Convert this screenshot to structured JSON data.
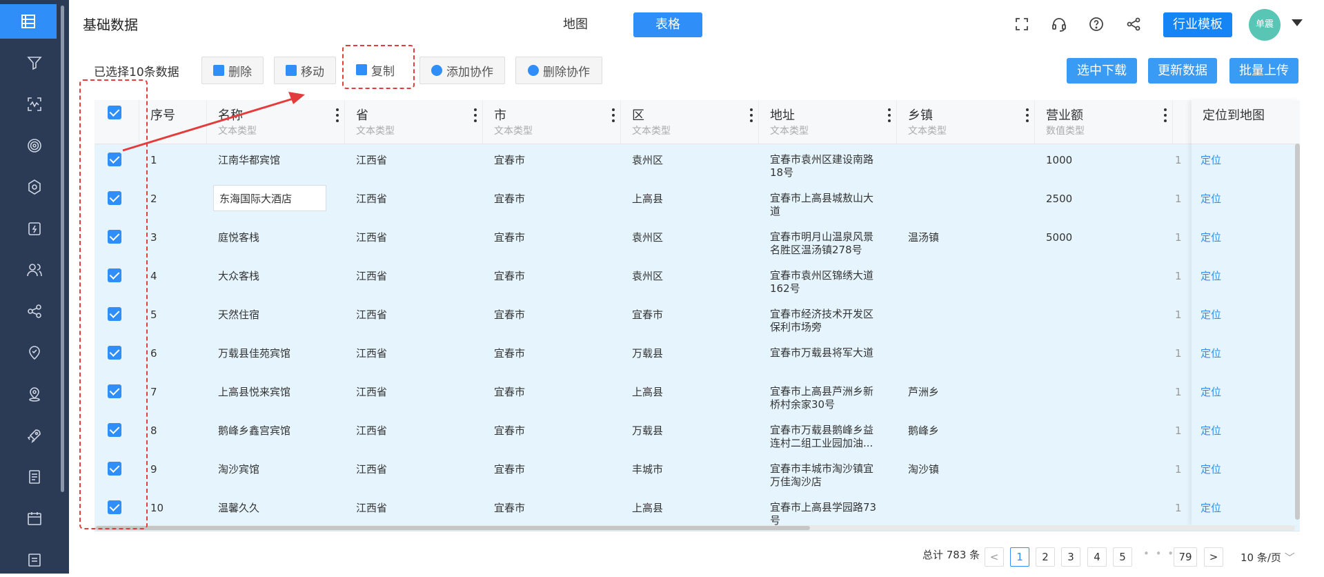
{
  "app": {
    "title": "基础数据",
    "view_tabs": [
      "地图",
      "表格"
    ],
    "industry_template_label": "行业模板",
    "avatar_text": "单震",
    "accent_color": "#2f8ef7"
  },
  "sidebar": {
    "icons": [
      "table-list-icon",
      "filter-icon",
      "heatmap-icon",
      "target-icon",
      "compass-icon",
      "clipboard-bolt-icon",
      "users-icon",
      "share-nodes-icon",
      "location-check-icon",
      "map-pin-icon",
      "rocket-icon",
      "document-icon",
      "calendar-icon",
      "notes-icon"
    ]
  },
  "actions": {
    "selected_text": "已选择10条数据",
    "delete_label": "删除",
    "move_label": "移动",
    "copy_label": "复制",
    "add_collab_label": "添加协作",
    "remove_collab_label": "删除协作",
    "download_selected_label": "选中下载",
    "update_data_label": "更新数据",
    "batch_upload_label": "批量上传"
  },
  "table": {
    "columns": [
      {
        "label": "序号",
        "sub": ""
      },
      {
        "label": "名称",
        "sub": "文本类型"
      },
      {
        "label": "省",
        "sub": "文本类型"
      },
      {
        "label": "市",
        "sub": "文本类型"
      },
      {
        "label": "区",
        "sub": "文本类型"
      },
      {
        "label": "地址",
        "sub": "文本类型"
      },
      {
        "label": "乡镇",
        "sub": "文本类型"
      },
      {
        "label": "营业额",
        "sub": "数值类型"
      }
    ],
    "locate_column_label": "定位到地图",
    "locate_label": "定位",
    "partial_cell": "1",
    "rows": [
      {
        "idx": "1",
        "name": "江南华都宾馆",
        "province": "江西省",
        "city": "宜春市",
        "district": "袁州区",
        "address": "宜春市袁州区建设南路18号",
        "town": "",
        "revenue": "1000"
      },
      {
        "idx": "2",
        "name": "东海国际大酒店",
        "province": "江西省",
        "city": "宜春市",
        "district": "上高县",
        "address": "宜春市上高县城敖山大道",
        "town": "",
        "revenue": "2500"
      },
      {
        "idx": "3",
        "name": "庭悦客栈",
        "province": "江西省",
        "city": "宜春市",
        "district": "袁州区",
        "address": "宜春市明月山温泉风景名胜区温汤镇278号",
        "town": "温汤镇",
        "revenue": "5000"
      },
      {
        "idx": "4",
        "name": "大众客栈",
        "province": "江西省",
        "city": "宜春市",
        "district": "袁州区",
        "address": "宜春市袁州区锦绣大道162号",
        "town": "",
        "revenue": ""
      },
      {
        "idx": "5",
        "name": "天然住宿",
        "province": "江西省",
        "city": "宜春市",
        "district": "宜春市",
        "address": "宜春市经济技术开发区保利市场旁",
        "town": "",
        "revenue": ""
      },
      {
        "idx": "6",
        "name": "万载县佳苑宾馆",
        "province": "江西省",
        "city": "宜春市",
        "district": "万载县",
        "address": "宜春市万载县将军大道",
        "town": "",
        "revenue": ""
      },
      {
        "idx": "7",
        "name": "上高县悦来宾馆",
        "province": "江西省",
        "city": "宜春市",
        "district": "上高县",
        "address": "宜春市上高县芦洲乡新桥村余家30号",
        "town": "芦洲乡",
        "revenue": ""
      },
      {
        "idx": "8",
        "name": "鹅峰乡鑫宫宾馆",
        "province": "江西省",
        "city": "宜春市",
        "district": "万载县",
        "address": "宜春市万载县鹅峰乡益连村二组工业园加油...",
        "town": "鹅峰乡",
        "revenue": ""
      },
      {
        "idx": "9",
        "name": "淘沙宾馆",
        "province": "江西省",
        "city": "宜春市",
        "district": "丰城市",
        "address": "宜春市丰城市淘沙镇宜万佳淘沙店",
        "town": "淘沙镇",
        "revenue": ""
      },
      {
        "idx": "10",
        "name": "温馨久久",
        "province": "江西省",
        "city": "宜春市",
        "district": "上高县",
        "address": "宜春市上高县学园路73号",
        "town": "",
        "revenue": ""
      }
    ]
  },
  "pagination": {
    "total_text": "总计 783 条",
    "pages": [
      "1",
      "2",
      "3",
      "4",
      "5"
    ],
    "ellipsis": "• • •",
    "last_page": "79",
    "current": "1",
    "per_page": "10 条/页",
    "prev": "<",
    "next": ">"
  },
  "annotation_color": "#e23c3c"
}
